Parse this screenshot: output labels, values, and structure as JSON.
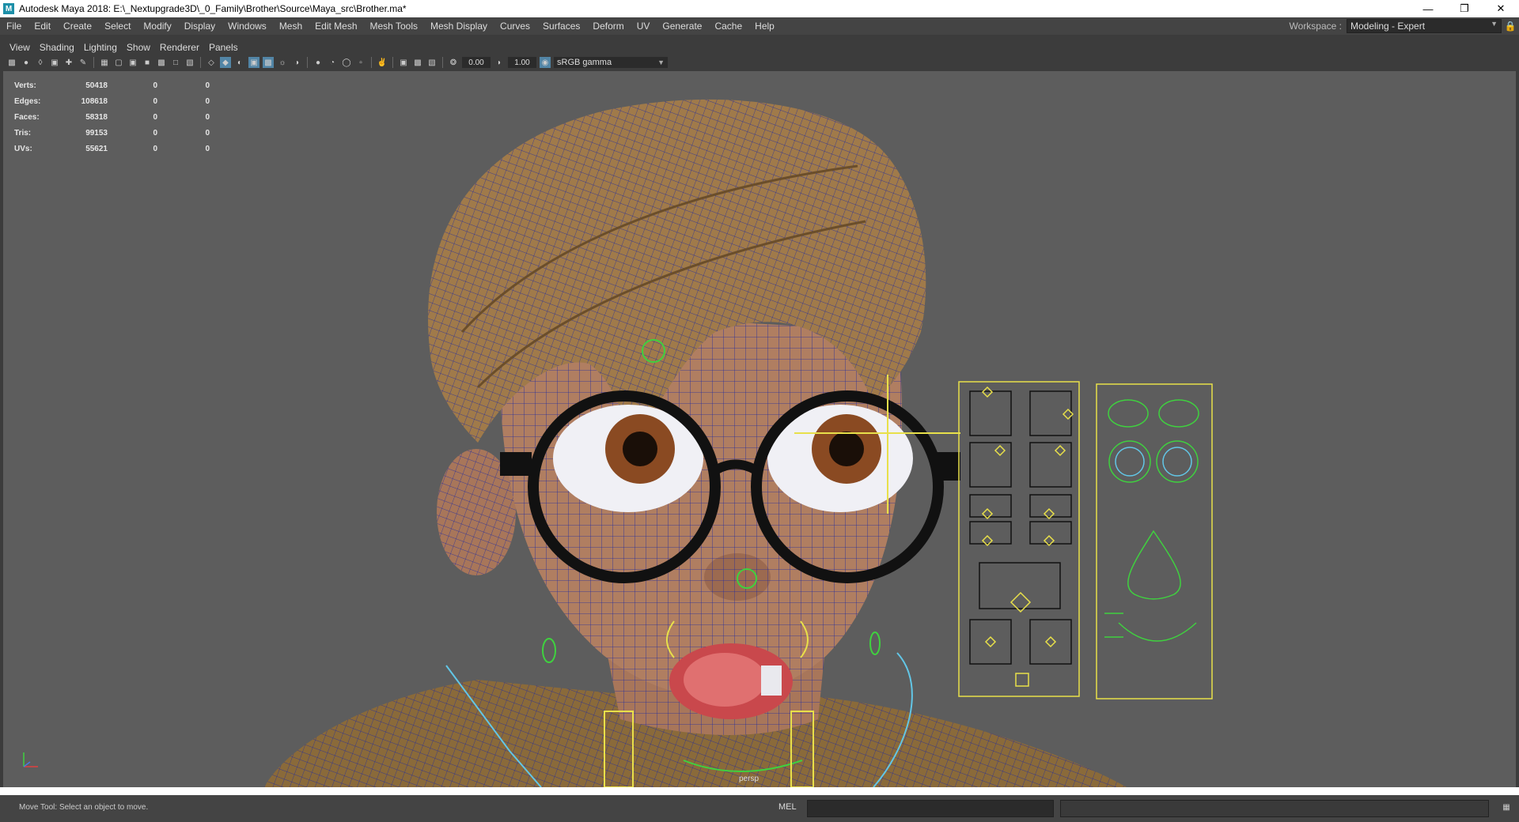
{
  "window": {
    "app_icon": "M",
    "title": "Autodesk Maya 2018: E:\\_Nextupgrade3D\\_0_Family\\Brother\\Source\\Maya_src\\Brother.ma*",
    "controls": [
      "minimize-icon",
      "restore-icon",
      "close-icon"
    ]
  },
  "menubar": {
    "items": [
      "File",
      "Edit",
      "Create",
      "Select",
      "Modify",
      "Display",
      "Windows",
      "Mesh",
      "Edit Mesh",
      "Mesh Tools",
      "Mesh Display",
      "Curves",
      "Surfaces",
      "Deform",
      "UV",
      "Generate",
      "Cache",
      "Help"
    ],
    "workspace_label": "Workspace :",
    "workspace_value": "Modeling - Expert"
  },
  "panel": {
    "menu": [
      "View",
      "Shading",
      "Lighting",
      "Show",
      "Renderer",
      "Panels"
    ],
    "exposure": "0.00",
    "gamma": "1.00",
    "color_space": "sRGB gamma",
    "camera": "persp"
  },
  "hud": {
    "rows": [
      {
        "label": "Verts:",
        "a": "50418",
        "b": "0",
        "c": "0"
      },
      {
        "label": "Edges:",
        "a": "108618",
        "b": "0",
        "c": "0"
      },
      {
        "label": "Faces:",
        "a": "58318",
        "b": "0",
        "c": "0"
      },
      {
        "label": "Tris:",
        "a": "99153",
        "b": "0",
        "c": "0"
      },
      {
        "label": "UVs:",
        "a": "55621",
        "b": "0",
        "c": "0"
      }
    ]
  },
  "status": {
    "help_line": "Move Tool: Select an object to move.",
    "command_language": "MEL"
  },
  "colors": {
    "viewport_bg": "#5d5d5d",
    "wire": "#1f2aa0",
    "skin": "#b07e61",
    "hair": "#a07a4a",
    "glasses": "#111111",
    "control_yellow": "#e8e04a",
    "control_green": "#3fd13f",
    "highlight_blue": "#5285a6"
  }
}
